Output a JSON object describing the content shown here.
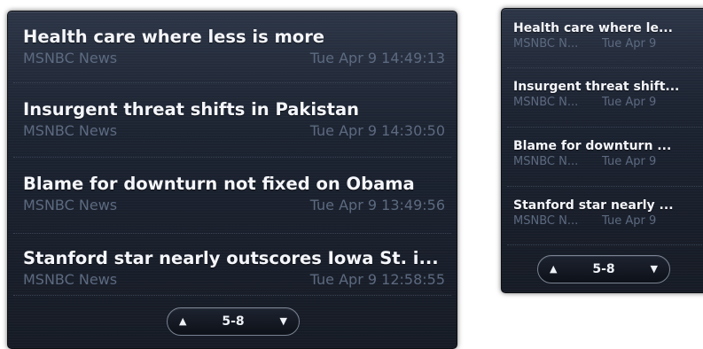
{
  "large_gadget": {
    "items": [
      {
        "headline": "Health care where less is more",
        "source": "MSNBC News",
        "date": "Tue Apr 9  14:49:13"
      },
      {
        "headline": "Insurgent threat shifts in Pakistan",
        "source": "MSNBC News",
        "date": "Tue Apr 9  14:30:50"
      },
      {
        "headline": "Blame for downturn not fixed on Obama",
        "source": "MSNBC News",
        "date": "Tue Apr 9  13:49:56"
      },
      {
        "headline": "Stanford star nearly outscores Iowa St. i...",
        "source": "MSNBC News",
        "date": "Tue Apr 9  12:58:55"
      }
    ],
    "pager": {
      "up_icon": "▲",
      "label": "5-8",
      "down_icon": "▼"
    }
  },
  "small_gadget": {
    "items": [
      {
        "headline": "Health care where le...",
        "source": "MSNBC N...",
        "date": "Tue Apr 9"
      },
      {
        "headline": "Insurgent threat shift...",
        "source": "MSNBC N...",
        "date": "Tue Apr 9"
      },
      {
        "headline": "Blame for downturn ...",
        "source": "MSNBC N...",
        "date": "Tue Apr 9"
      },
      {
        "headline": "Stanford star nearly ...",
        "source": "MSNBC N...",
        "date": "Tue Apr 9"
      }
    ],
    "pager": {
      "up_icon": "▲",
      "label": "5-8",
      "down_icon": "▼"
    }
  }
}
